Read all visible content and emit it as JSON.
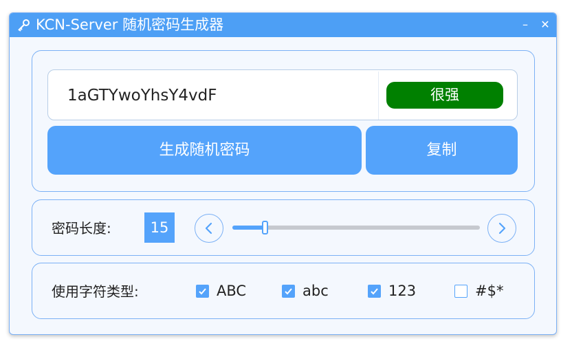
{
  "window": {
    "title": "KCN-Server 随机密码生成器",
    "minimize_glyph": "–",
    "close_glyph": "✕"
  },
  "password": {
    "value": "1aGTYwoYhsY4vdF",
    "strength": "很强",
    "strength_color": "#008000"
  },
  "buttons": {
    "generate": "生成随机密码",
    "copy": "复制"
  },
  "length": {
    "label": "密码长度:",
    "value": "15",
    "slider_fraction": 0.13
  },
  "types": {
    "label": "使用字符类型:",
    "options": [
      {
        "label": "ABC",
        "checked": true
      },
      {
        "label": "abc",
        "checked": true
      },
      {
        "label": "123",
        "checked": true
      },
      {
        "label": "#$*",
        "checked": false
      }
    ]
  },
  "colors": {
    "accent": "#54a3fb",
    "titlebar": "#4d9ff5",
    "border": "#7ab0f5"
  }
}
